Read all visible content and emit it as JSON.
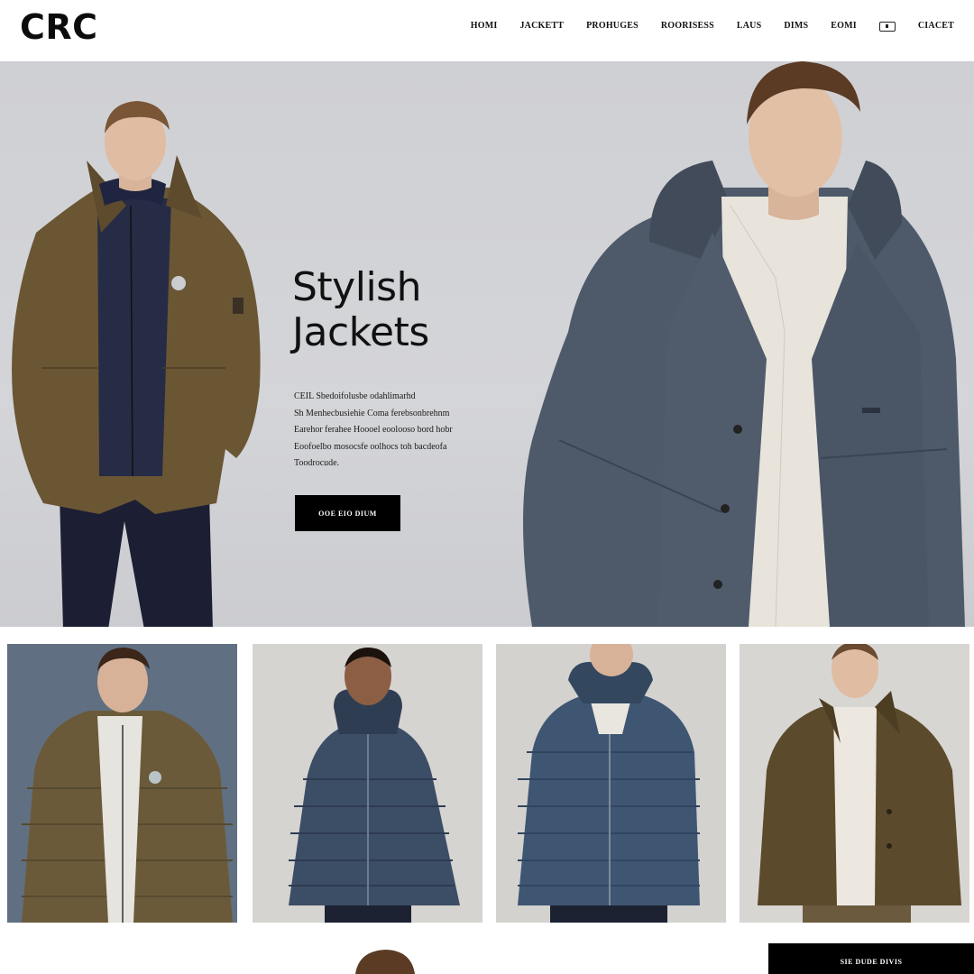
{
  "brand": {
    "logo": "CRC"
  },
  "nav": {
    "items": [
      "HOMI",
      "JACKETT",
      "PROHUGES",
      "ROORISESS",
      "LAUS",
      "DIMS",
      "EOMI"
    ],
    "last": "CIACET"
  },
  "hero": {
    "title_line1": "Stylish",
    "title_line2": "Jackets",
    "description_lines": [
      "CEIL Sbedoifolusbe odahlimarhd",
      "Sh Menhecbusiehie Coma ferebsonbrehnm",
      "Earehor ferahee Hoooel eoolooso bord hobr",
      "Eoofoelbo mosocsfe oolhocs toh bacdeofa",
      "Toodrocude."
    ],
    "cta": "OOE EIO DIUM"
  },
  "products": [
    {
      "name": "olive-puffer-jacket",
      "color": "#6b5a3a"
    },
    {
      "name": "navy-hooded-puffer",
      "color": "#3c4d66"
    },
    {
      "name": "blue-hooded-puffer",
      "color": "#3f5672"
    },
    {
      "name": "olive-field-jacket",
      "color": "#5c4a2c"
    }
  ],
  "footer": {
    "cta": "SIE DUDE DIVIS"
  }
}
